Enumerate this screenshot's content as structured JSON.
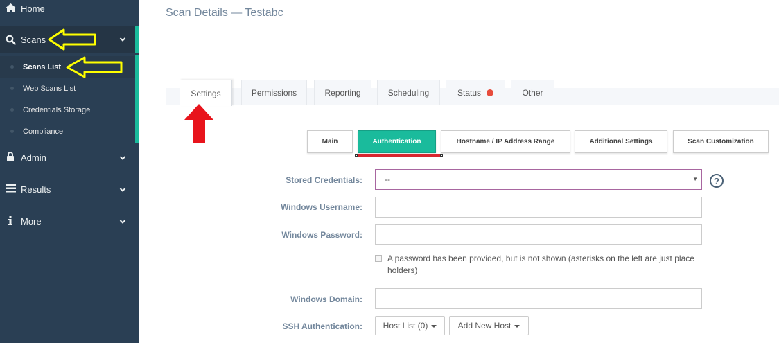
{
  "sidebar": {
    "items": [
      {
        "label": "Home",
        "icon": "home-icon"
      },
      {
        "label": "Scans",
        "icon": "search-icon"
      },
      {
        "label": "Admin",
        "icon": "lock-icon"
      },
      {
        "label": "Results",
        "icon": "list-icon"
      },
      {
        "label": "More",
        "icon": "info-icon"
      }
    ],
    "submenu": [
      "Scans List",
      "Web Scans List",
      "Credentials Storage",
      "Compliance"
    ]
  },
  "page": {
    "title": "Scan Details — Testabc"
  },
  "tabs": [
    "Settings",
    "Permissions",
    "Reporting",
    "Scheduling",
    "Status",
    "Other"
  ],
  "subtabs": [
    "Main",
    "Authentication",
    "Hostname / IP Address Range",
    "Additional Settings",
    "Scan Customization"
  ],
  "form": {
    "stored_credentials": {
      "label": "Stored Credentials:",
      "value": "--"
    },
    "windows_username": {
      "label": "Windows Username:",
      "value": ""
    },
    "windows_password": {
      "label": "Windows Password:",
      "value": ""
    },
    "password_note": "A password has been provided, but is not shown (asterisks on the left are just place holders)",
    "windows_domain": {
      "label": "Windows Domain:",
      "value": ""
    },
    "ssh": {
      "label": "SSH Authentication:",
      "host_list": "Host List (0)",
      "add_host": "Add New Host"
    }
  },
  "colors": {
    "sidebar_bg": "#2a3f54",
    "accent": "#1abb9c",
    "status_red": "#e74c3c",
    "annotation_yellow": "#ffff00",
    "annotation_red": "#e8141c"
  }
}
